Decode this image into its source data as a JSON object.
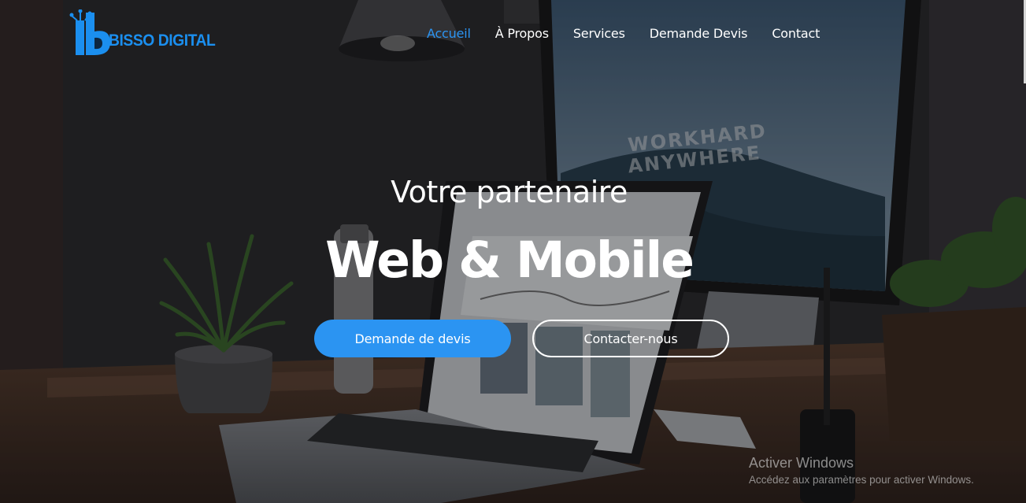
{
  "brand": {
    "name": "BISSO DIGITAL",
    "color": "#1b8fef"
  },
  "nav": {
    "items": [
      {
        "label": "Accueil",
        "active": true
      },
      {
        "label": "À Propos",
        "active": false
      },
      {
        "label": "Services",
        "active": false
      },
      {
        "label": "Demande Devis",
        "active": false
      },
      {
        "label": "Contact",
        "active": false
      }
    ],
    "active_color": "#2c95f3"
  },
  "hero": {
    "subtitle": "Votre partenaire",
    "title": "Web & Mobile",
    "primary_button": "Demande de devis",
    "secondary_button": "Contacter-nous",
    "background_screen_text_1": "WORKHARD",
    "background_screen_text_2": "ANYWHERE",
    "accent_color": "#2b94f2"
  },
  "watermark": {
    "title": "Activer Windows",
    "subtitle": "Accédez aux paramètres pour activer Windows."
  }
}
